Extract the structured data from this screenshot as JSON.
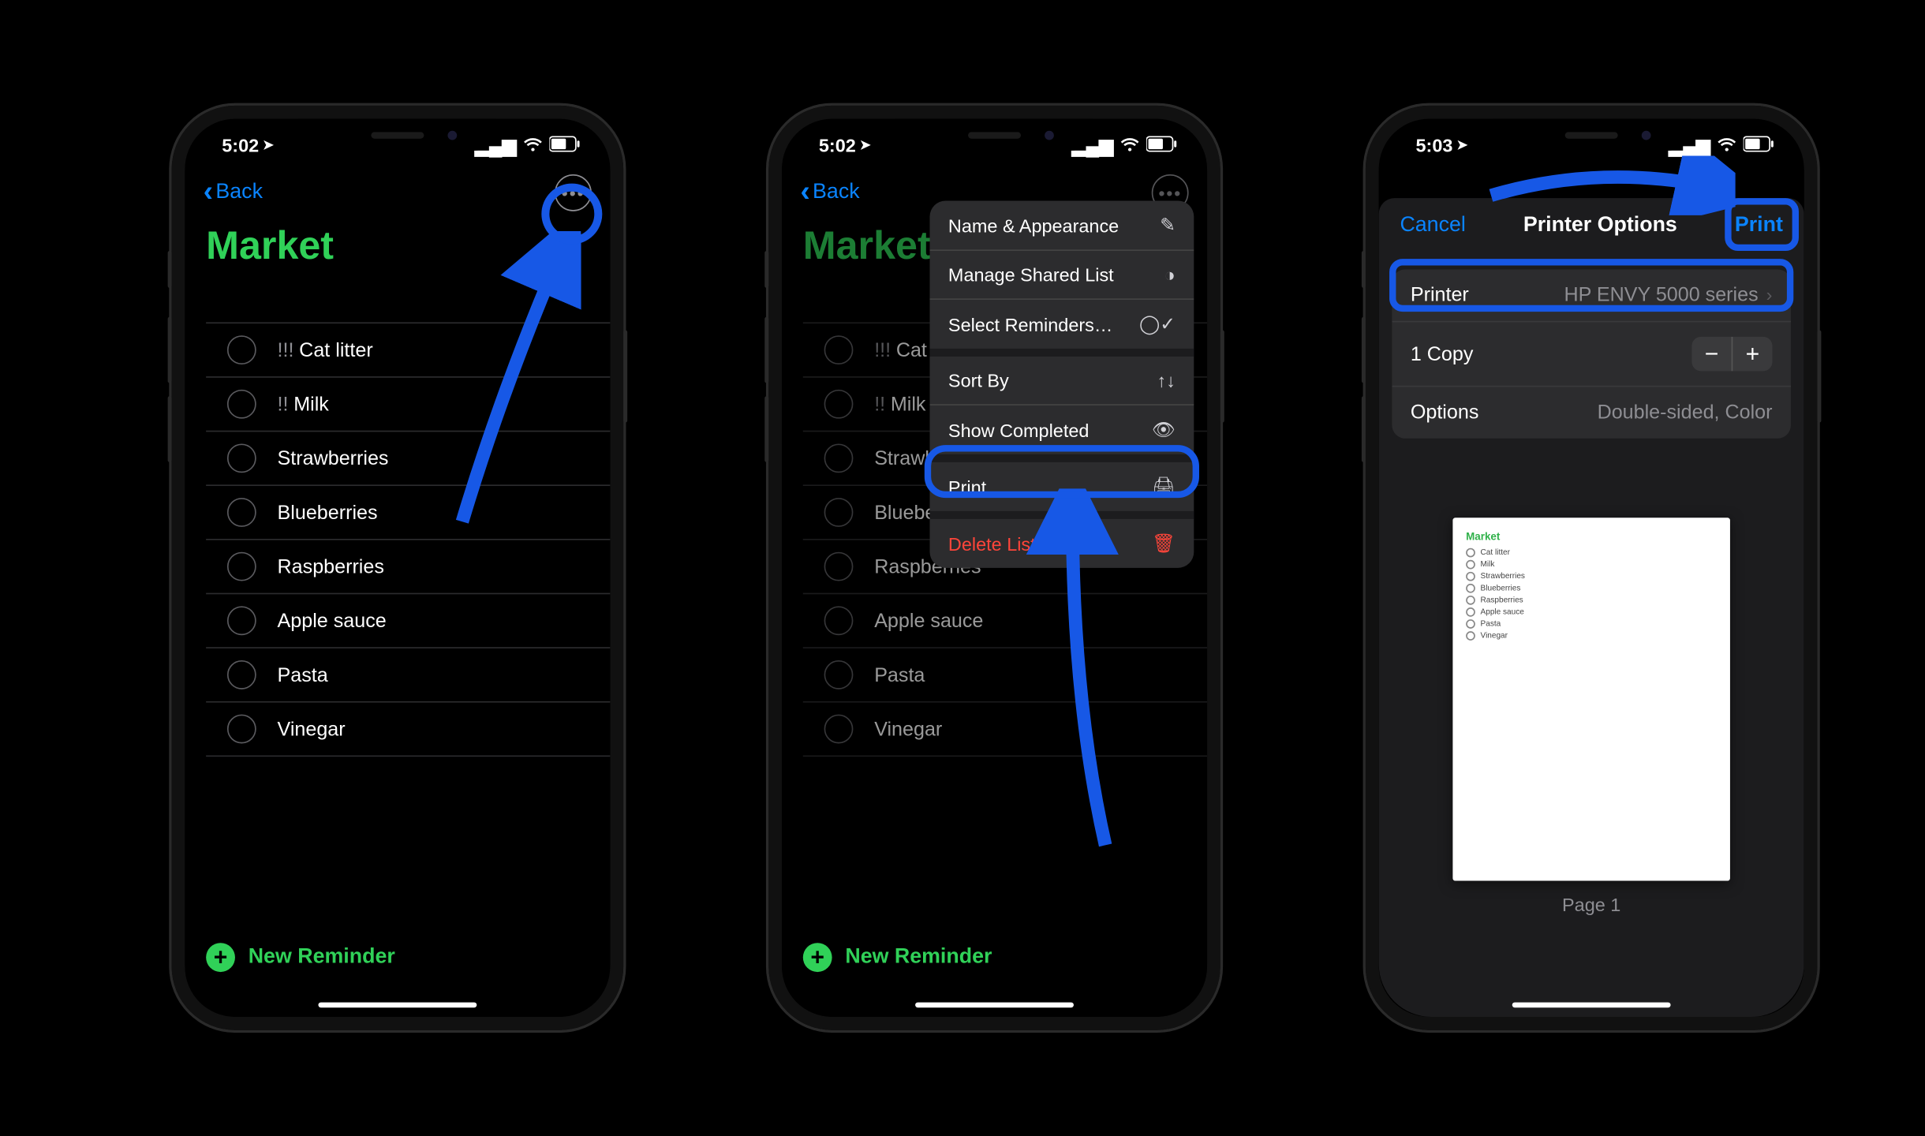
{
  "statusbar": {
    "time12": "5:02",
    "time3": "5:03",
    "locArrow": "➤"
  },
  "nav": {
    "back": "Back"
  },
  "list": {
    "title": "Market",
    "items": [
      {
        "priority": "!!!",
        "text": "Cat litter"
      },
      {
        "priority": "!!",
        "text": "Milk"
      },
      {
        "priority": "",
        "text": "Strawberries"
      },
      {
        "priority": "",
        "text": "Blueberries"
      },
      {
        "priority": "",
        "text": "Raspberries"
      },
      {
        "priority": "",
        "text": "Apple sauce"
      },
      {
        "priority": "",
        "text": "Pasta"
      },
      {
        "priority": "",
        "text": "Vinegar"
      }
    ],
    "newReminder": "New Reminder"
  },
  "menu": {
    "nameAppearance": "Name & Appearance",
    "manageShared": "Manage Shared List",
    "selectReminders": "Select Reminders…",
    "sortBy": "Sort By",
    "showCompleted": "Show Completed",
    "print": "Print",
    "deleteList": "Delete List"
  },
  "printSheet": {
    "cancel": "Cancel",
    "title": "Printer Options",
    "print": "Print",
    "printerLabel": "Printer",
    "printerValue": "HP ENVY 5000 series",
    "copies": "1 Copy",
    "optionsLabel": "Options",
    "optionsValue": "Double-sided, Color",
    "pageLabel": "Page 1"
  },
  "colors": {
    "blue": "#0a84ff",
    "green": "#30d158",
    "red": "#ff453a",
    "annotation": "#1758e6"
  }
}
